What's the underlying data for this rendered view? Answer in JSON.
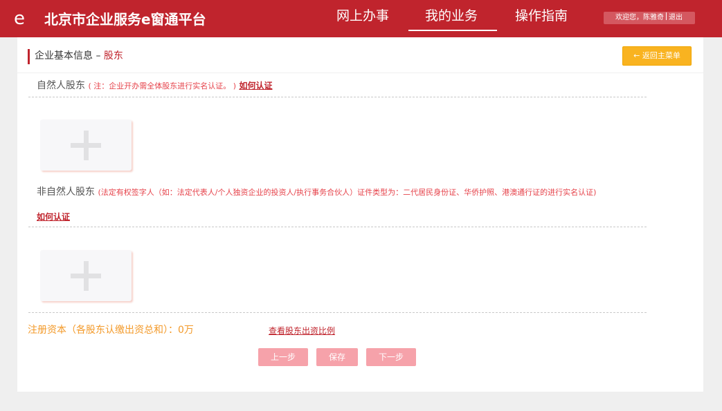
{
  "header": {
    "logo_glyph": "e",
    "brand": "北京市企业服务e窗通平台",
    "nav": [
      "网上办事",
      "我的业务",
      "操作指南"
    ],
    "active_nav": "我的业务",
    "user": {
      "welcome": "欢迎您，陈雅奇",
      "logout": "退出"
    }
  },
  "page": {
    "title": "企业基本信息 – ",
    "subtitle": "股东",
    "back_button": "← 返回主菜单"
  },
  "natural": {
    "label": "自然人股东",
    "note": "( 注：企业开办需全体股东进行实名认证。 )",
    "how_link": "如何认证"
  },
  "nonnatural": {
    "label": "非自然人股东",
    "note": "(法定有权签字人（如：法定代表人/个人独资企业的投资人/执行事务合伙人）证件类型为：二代居民身份证、华侨护照、港澳通行证的进行实名认证)",
    "how_link": "如何认证"
  },
  "capital": {
    "text": "注册资本（各股东认缴出资总和）：0万",
    "ratio_link": "查看股东出资比例"
  },
  "buttons": {
    "prev": "上一步",
    "save": "保存",
    "next": "下一步"
  },
  "colors": {
    "brand_red": "#c0242d",
    "back_button": "#f9b320",
    "disabled_button": "#f6a2aa",
    "capital_text": "#f39a2a"
  }
}
